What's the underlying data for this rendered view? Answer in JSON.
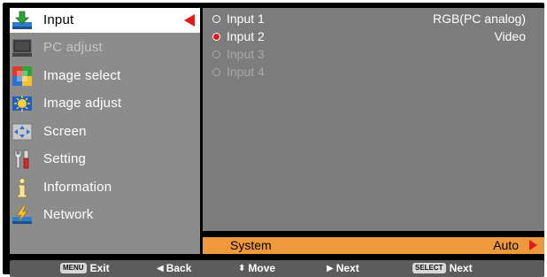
{
  "menu": {
    "items": [
      {
        "label": "Input",
        "icon": "input-icon",
        "state": "selected"
      },
      {
        "label": "PC adjust",
        "icon": "pc-adjust-icon",
        "state": "disabled"
      },
      {
        "label": "Image select",
        "icon": "image-select-icon",
        "state": "normal"
      },
      {
        "label": "Image adjust",
        "icon": "image-adjust-icon",
        "state": "normal"
      },
      {
        "label": "Screen",
        "icon": "screen-icon",
        "state": "normal"
      },
      {
        "label": "Setting",
        "icon": "setting-icon",
        "state": "normal"
      },
      {
        "label": "Information",
        "icon": "information-icon",
        "state": "normal"
      },
      {
        "label": "Network",
        "icon": "network-icon",
        "state": "normal"
      }
    ]
  },
  "inputs": [
    {
      "label": "Input 1",
      "value": "RGB(PC analog)",
      "checked": false,
      "enabled": true
    },
    {
      "label": "Input 2",
      "value": "Video",
      "checked": true,
      "enabled": true
    },
    {
      "label": "Input 3",
      "value": "",
      "checked": false,
      "enabled": false
    },
    {
      "label": "Input 4",
      "value": "",
      "checked": false,
      "enabled": false
    }
  ],
  "system": {
    "label": "System",
    "value": "Auto"
  },
  "hints": {
    "exit_key": "MENU",
    "exit_label": "Exit",
    "back_label": "Back",
    "move_label": "Move",
    "next_label": "Next",
    "select_key": "SELECT",
    "select_label": "Next"
  },
  "colors": {
    "accent_red": "#e11b1b",
    "highlight_orange": "#ee9a3c",
    "menu_bg": "#8c8c8c",
    "panel_bg": "#7c7c7c"
  }
}
